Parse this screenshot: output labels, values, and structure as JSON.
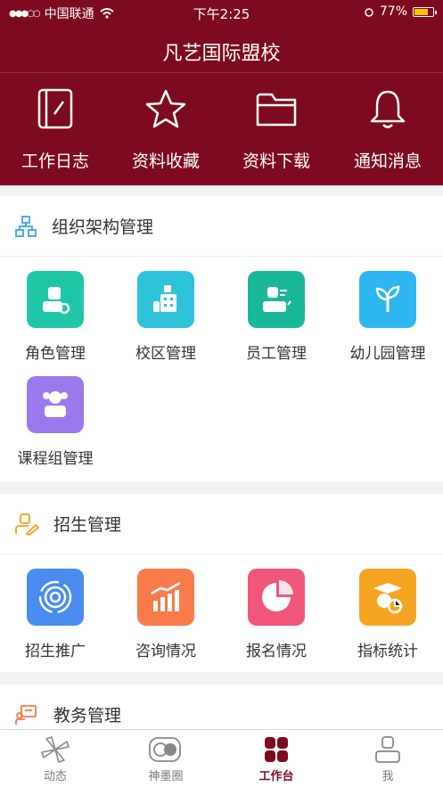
{
  "status_bar": {
    "carrier": "中国联通",
    "time": "下午2:25",
    "battery": "77%",
    "battery_level": 0.77
  },
  "header": {
    "title": "凡艺国际盟校",
    "quick_actions": [
      {
        "label": "工作日志",
        "icon": "notebook-icon"
      },
      {
        "label": "资料收藏",
        "icon": "star-icon"
      },
      {
        "label": "资料下载",
        "icon": "folder-icon"
      },
      {
        "label": "通知消息",
        "icon": "bell-icon"
      }
    ]
  },
  "sections": [
    {
      "title": "组织架构管理",
      "icon": "org-chart-icon",
      "items": [
        {
          "label": "角色管理",
          "icon": "role-icon",
          "color": "#1fc7a8"
        },
        {
          "label": "校区管理",
          "icon": "campus-icon",
          "color": "#2ec2d8"
        },
        {
          "label": "员工管理",
          "icon": "employee-icon",
          "color": "#1ab89a"
        },
        {
          "label": "幼儿园管理",
          "icon": "sprout-icon",
          "color": "#2eb6f0"
        },
        {
          "label": "课程组管理",
          "icon": "course-group-icon",
          "color": "#9b79ec"
        }
      ]
    },
    {
      "title": "招生管理",
      "icon": "person-edit-icon",
      "items": [
        {
          "label": "招生推广",
          "icon": "target-icon",
          "color": "#4a8cf0"
        },
        {
          "label": "咨询情况",
          "icon": "bar-trend-icon",
          "color": "#f97a4a"
        },
        {
          "label": "报名情况",
          "icon": "pie-icon",
          "color": "#f0577b"
        },
        {
          "label": "指标统计",
          "icon": "graduate-icon",
          "color": "#f6a522"
        }
      ]
    },
    {
      "title": "教务管理",
      "icon": "teaching-icon",
      "items": []
    }
  ],
  "tabbar": [
    {
      "label": "动态",
      "icon": "pinwheel-icon",
      "active": false
    },
    {
      "label": "神墨圈",
      "icon": "circle-toggle-icon",
      "active": false
    },
    {
      "label": "工作台",
      "icon": "grid-icon",
      "active": true
    },
    {
      "label": "我",
      "icon": "profile-icon",
      "active": false
    }
  ]
}
